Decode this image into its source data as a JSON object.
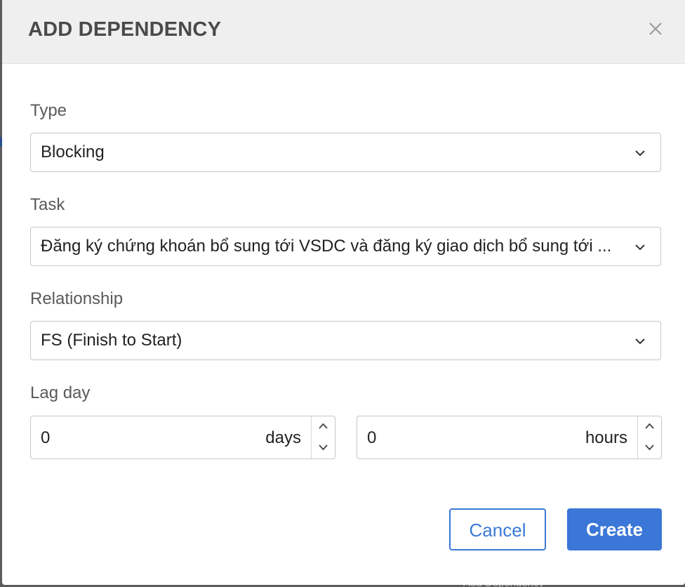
{
  "backdrop": {
    "peek_text": "Add Dependency"
  },
  "dialog": {
    "title": "ADD DEPENDENCY",
    "close_icon": "close-icon"
  },
  "form": {
    "type": {
      "label": "Type",
      "value": "Blocking"
    },
    "task": {
      "label": "Task",
      "value": "Đăng ký chứng khoán bổ sung tới VSDC và đăng ký giao dịch bổ sung tới ..."
    },
    "relationship": {
      "label": "Relationship",
      "value": "FS (Finish to Start)"
    },
    "lag": {
      "label": "Lag day",
      "days_value": "0",
      "days_unit": "days",
      "hours_value": "0",
      "hours_unit": "hours"
    }
  },
  "actions": {
    "cancel_label": "Cancel",
    "create_label": "Create"
  },
  "colors": {
    "accent": "#3a77d6",
    "header_bg": "#efefef",
    "backdrop": "#5c5c5c"
  }
}
